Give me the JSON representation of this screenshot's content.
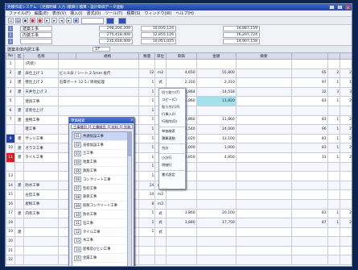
{
  "window": {
    "title": "見積作成システム - [見積明細 入力 (積算)] 積算・設計単価データ連動",
    "controls": [
      "_",
      "□",
      "×"
    ]
  },
  "menu": [
    "ファイル(F)",
    "編集(E)",
    "表示(V)",
    "挿入(I)",
    "書式(O)",
    "ツール(T)",
    "積算(S)",
    "ウィンドウ(W)",
    "ヘルプ(H)"
  ],
  "toolbar": {
    "icons": [
      "new-icon",
      "open-icon",
      "save-icon",
      "print-icon",
      "cut-icon",
      "copy-icon",
      "paste-icon",
      "undo-icon",
      "redo-icon",
      "calc-icon"
    ]
  },
  "summary": {
    "rows": [
      {
        "tag": "1",
        "name": "建築工事",
        "v1": "298,204,200",
        "v2": "10,035,124",
        "v3": "14,887,159"
      },
      {
        "tag": "2",
        "name": "内装工事",
        "v1": "275,418,400",
        "v2": "12,855,126",
        "v3": "16,207,724"
      },
      {
        "tag": "3",
        "name": "",
        "v1": "235,618,400",
        "v2": "10,051,025",
        "v3": "14,907,158"
      }
    ]
  },
  "label_row": {
    "title": "建築本体内訳工事",
    "field": "1F"
  },
  "grid": {
    "headers": [
      "No",
      "区",
      "名称",
      "",
      "規格",
      "数量",
      "単位",
      "単価",
      "金額",
      "摘要",
      "",
      "",
      ""
    ],
    "rows": [
      {
        "no": "1",
        "k": "",
        "name": "(内装)",
        "spec": "",
        "qty": "",
        "unit": "",
        "price": "",
        "amt": "",
        "note": "",
        "a": "",
        "b": "",
        "c": ""
      },
      {
        "no": "2",
        "k": "建",
        "name": "床仕上げ 1",
        "spec": "ビニル床 / シート 2.5mm 長尺",
        "qty": "12",
        "unit": "m2",
        "price": "4,650",
        "amt": "55,800",
        "note": "",
        "a": "65",
        "b": "2",
        "c": "2"
      },
      {
        "no": "3",
        "k": "建",
        "name": "壁仕上げ 2",
        "spec": "石膏ボード 12.5 / 目地処理",
        "qty": "1",
        "unit": "式",
        "price": "2,310",
        "amt": "2,310",
        "note": "",
        "a": "97",
        "b": "1",
        "c": "1"
      },
      {
        "no": "4",
        "k": "建",
        "name": "天井仕上げ 3",
        "spec": "",
        "qty": "1",
        "unit": "式",
        "price": "1,864",
        "amt": "14,518",
        "note": "",
        "a": "32",
        "b": "3",
        "c": "3"
      },
      {
        "no": "5",
        "k": "",
        "name": "建具工事",
        "spec": "",
        "qty": "1",
        "unit": "式",
        "price": "1,860",
        "amt": "11,820",
        "note": "",
        "a": "83",
        "b": "1",
        "c": "2"
      },
      {
        "no": "6",
        "k": "建",
        "name": "塗装仕上げ",
        "spec": "",
        "qty": "1",
        "unit": "式",
        "price": "",
        "amt": "",
        "note": "",
        "a": "",
        "b": "",
        "c": ""
      },
      {
        "no": "7",
        "k": "建",
        "name": "金物工事",
        "spec": "",
        "qty": "1",
        "unit": "式",
        "price": "1,860",
        "amt": "11,860",
        "note": "",
        "a": "83",
        "b": "1",
        "c": "2"
      },
      {
        "no": "8",
        "k": "",
        "name": "雑工事",
        "spec": "",
        "qty": "1",
        "unit": "式",
        "price": "2,540",
        "amt": "24,000",
        "note": "",
        "a": "96",
        "b": "1",
        "c": "2"
      },
      {
        "no": "9",
        "k": "建",
        "name": "サッシ工事",
        "spec": "",
        "qty": "1",
        "unit": "式",
        "price": "1,020",
        "amt": "12,100",
        "note": "",
        "a": "83",
        "b": "1",
        "c": "2"
      },
      {
        "no": "10",
        "k": "建",
        "name": "ガラス工事",
        "spec": "",
        "qty": "1",
        "unit": "式",
        "price": "1,000",
        "amt": "1,000",
        "note": "",
        "a": "83",
        "b": "1",
        "c": "2"
      },
      {
        "no": "11",
        "k": "建",
        "name": "タイル工事",
        "spec": "",
        "qty": "1",
        "unit": "式",
        "price": "4,850",
        "amt": "4,850",
        "note": "",
        "a": "31",
        "b": "1",
        "c": "2"
      },
      {
        "no": "12",
        "k": "",
        "name": "",
        "spec": "",
        "qty": "1",
        "unit": "式",
        "price": "",
        "amt": "",
        "note": "",
        "a": "",
        "b": "",
        "c": ""
      },
      {
        "no": "13",
        "k": "",
        "name": "",
        "spec": "",
        "qty": "1",
        "unit": "式",
        "price": "",
        "amt": "",
        "note": "",
        "a": "",
        "b": "",
        "c": ""
      },
      {
        "no": "14",
        "k": "建",
        "name": "防水工事",
        "spec": "",
        "qty": "14",
        "unit": "m2",
        "price": "",
        "amt": "",
        "note": "",
        "a": "",
        "b": "",
        "c": ""
      },
      {
        "no": "15",
        "k": "",
        "name": "左官工事",
        "spec": "",
        "qty": "10",
        "unit": "m2",
        "price": "",
        "amt": "",
        "note": "",
        "a": "",
        "b": "",
        "c": ""
      },
      {
        "no": "16",
        "k": "",
        "name": "屋根工事",
        "spec": "",
        "qty": "8",
        "unit": "m2",
        "price": "",
        "amt": "",
        "note": "",
        "a": "",
        "b": "",
        "c": ""
      },
      {
        "no": "17",
        "k": "建",
        "name": "内装工事",
        "spec": "",
        "qty": "1",
        "unit": "式",
        "price": "3,860",
        "amt": "20,100",
        "note": "",
        "a": "83",
        "b": "1",
        "c": "2"
      },
      {
        "no": "18",
        "k": "",
        "name": "",
        "spec": "",
        "qty": "1",
        "unit": "式",
        "price": "3,880",
        "amt": "17,750",
        "note": "",
        "a": "87",
        "b": "1",
        "c": "2"
      },
      {
        "no": "19",
        "k": "建",
        "name": "",
        "spec": "",
        "qty": "1",
        "unit": "式",
        "price": "",
        "amt": "",
        "note": "",
        "a": "",
        "b": "",
        "c": ""
      },
      {
        "no": "20",
        "k": "",
        "name": "",
        "spec": "",
        "qty": "",
        "unit": "",
        "price": "",
        "amt": "",
        "note": "",
        "a": "",
        "b": "",
        "c": ""
      },
      {
        "no": "21",
        "k": "",
        "name": "",
        "spec": "",
        "qty": "",
        "unit": "",
        "price": "",
        "amt": "",
        "note": "",
        "a": "",
        "b": "",
        "c": ""
      },
      {
        "no": "22",
        "k": "",
        "name": "",
        "spec": "",
        "qty": "",
        "unit": "",
        "price": "",
        "amt": "",
        "note": "",
        "a": "",
        "b": "",
        "c": ""
      }
    ]
  },
  "popup": {
    "title": "単価検索",
    "close": "×",
    "tabs": [
      "工事種別",
      "工種細目",
      "材料",
      "労務"
    ],
    "items": [
      {
        "code": "01",
        "text": "共通仮設工事"
      },
      {
        "code": "02",
        "text": "直接仮設工事"
      },
      {
        "code": "03",
        "text": "土工事"
      },
      {
        "code": "04",
        "text": "地業工事"
      },
      {
        "code": "05",
        "text": "鉄筋工事"
      },
      {
        "code": "06",
        "text": "コンクリート工事"
      },
      {
        "code": "07",
        "text": "型枠工事"
      },
      {
        "code": "08",
        "text": "鉄骨工事"
      },
      {
        "code": "09",
        "text": "既製コンクリート工事"
      },
      {
        "code": "10",
        "text": "防水工事"
      },
      {
        "code": "11",
        "text": "石工事"
      },
      {
        "code": "12",
        "text": "タイル工事"
      },
      {
        "code": "13",
        "text": "木工事"
      },
      {
        "code": "14",
        "text": "屋根及びとい工事"
      },
      {
        "code": "15",
        "text": "金属工事"
      }
    ]
  },
  "context_menu": {
    "items": [
      "切り取り(T)",
      "コピー(C)",
      "貼り付け(P)",
      "行挿入(I)",
      "行削除(D)",
      "",
      "単価検索",
      "積算連動",
      "",
      "合計",
      "",
      "小計行",
      "明細行",
      "",
      "書式設定"
    ]
  },
  "colors": {
    "title_bar": "#1e44a8",
    "highlight_cell": "#a6e0ea",
    "side_mark_blue": "#2340a0",
    "side_mark_red": "#d21f1f",
    "background": "#0d2450"
  }
}
